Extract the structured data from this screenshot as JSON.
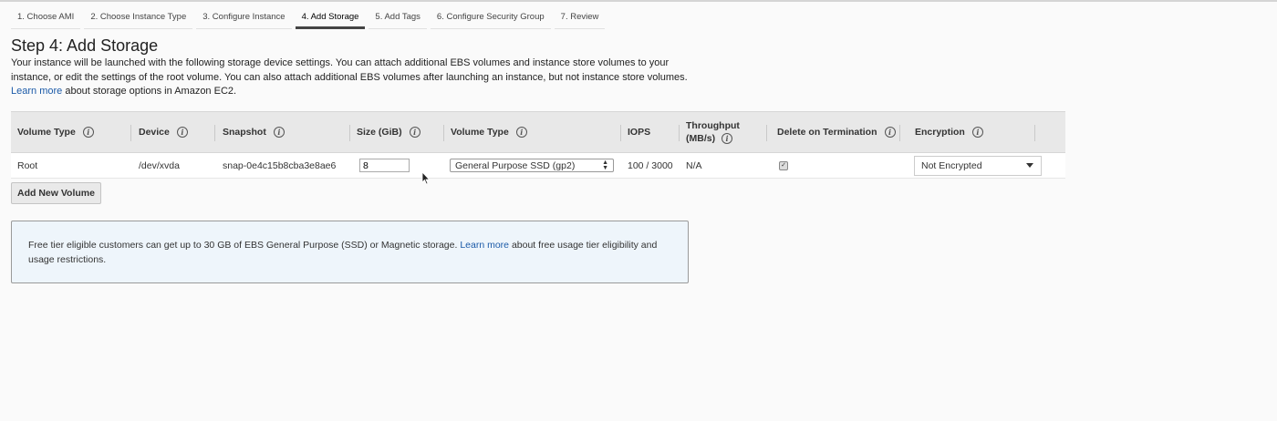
{
  "wizard": {
    "steps": [
      "1. Choose AMI",
      "2. Choose Instance Type",
      "3. Configure Instance",
      "4. Add Storage",
      "5. Add Tags",
      "6. Configure Security Group",
      "7. Review"
    ],
    "active_index": 3
  },
  "page": {
    "title": "Step 4: Add Storage",
    "intro_text": "Your instance will be launched with the following storage device settings. You can attach additional EBS volumes and instance store volumes to your instance, or edit the settings of the root volume. You can also attach additional EBS volumes after launching an instance, but not instance store volumes.",
    "intro_link": "Learn more",
    "intro_suffix": "about storage options in Amazon EC2."
  },
  "table": {
    "headers": {
      "volume_type": "Volume Type",
      "device": "Device",
      "snapshot": "Snapshot",
      "size": "Size (GiB)",
      "volume_type2": "Volume Type",
      "iops": "IOPS",
      "throughput_line1": "Throughput",
      "throughput_line2": "(MB/s)",
      "delete": "Delete on Termination",
      "encryption": "Encryption"
    },
    "row": {
      "volume_type": "Root",
      "device": "/dev/xvda",
      "snapshot": "snap-0e4c15b8cba3e8ae6",
      "size": "8",
      "volume_type_select": "General Purpose SSD (gp2)",
      "iops": "100 / 3000",
      "throughput": "N/A",
      "delete_on_termination": true,
      "encryption": "Not Encrypted"
    }
  },
  "add_button": "Add New Volume",
  "notice": {
    "text": "Free tier eligible customers can get up to 30 GB of EBS General Purpose (SSD) or Magnetic storage.",
    "link": "Learn more",
    "suffix": "about free usage tier eligibility and usage restrictions."
  },
  "icons": {
    "info": "info-icon",
    "caret": "chevron-down-icon",
    "cursor": "mouse-pointer-icon"
  }
}
